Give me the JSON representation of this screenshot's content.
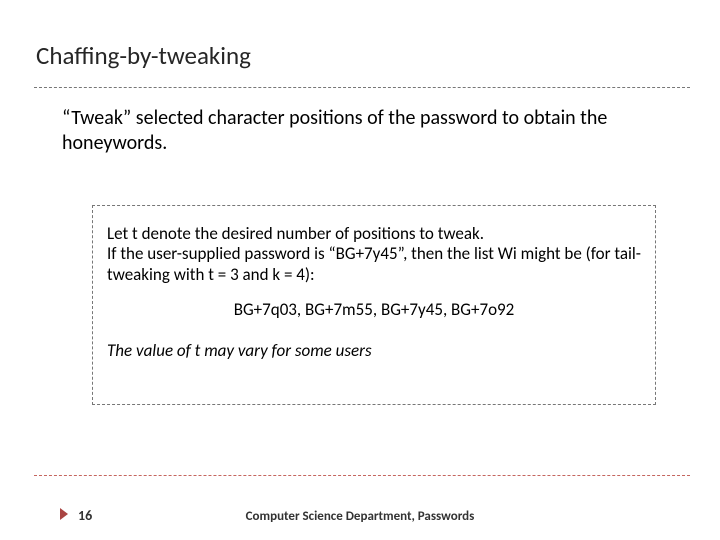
{
  "title": "Chaffing-by-tweaking",
  "intro": "“Tweak” selected character positions of the password to obtain the honeywords.",
  "box": {
    "para": "Let t denote the desired number of positions to tweak.\nIf the user-supplied password is “BG+7y45”, then the list Wi might be (for tail-tweaking with t = 3 and k = 4):",
    "example": "BG+7q03, BG+7m55, BG+7y45, BG+7o92",
    "note": "The value of t may vary for some users"
  },
  "footer": {
    "page": "16",
    "text": "Computer Science Department, Passwords"
  }
}
